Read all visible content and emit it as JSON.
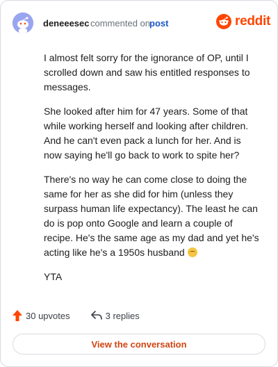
{
  "header": {
    "username": "deneeesec",
    "action_text": "commented on",
    "post_link": "post",
    "brand": "reddit"
  },
  "comment": {
    "paragraphs": [
      "I almost felt sorry for the ignorance of OP, until I scrolled down and saw his entitled responses to messages.",
      "She looked after him for 47 years. Some of that while working herself and looking after children. And he can't even pack a lunch for her. And is now saying he'll go back to work to spite her?",
      "There's no way he can come close to doing the same for her as she did for him (unless they surpass human life expectancy). The least he can do is pop onto Google and learn a couple of recipe. He's the same age as my dad and yet he's acting like he's a 1950s husband",
      "YTA"
    ]
  },
  "footer": {
    "upvotes": "30 upvotes",
    "replies": "3 replies",
    "cta": "View the conversation"
  },
  "colors": {
    "brand": "#ff4500",
    "link": "#1a56c8",
    "cta_text": "#d14410"
  },
  "icons": {
    "upvote": "upvote-arrow-icon",
    "reply": "reply-arrow-icon",
    "emoji": "grimacing-face-emoji"
  }
}
